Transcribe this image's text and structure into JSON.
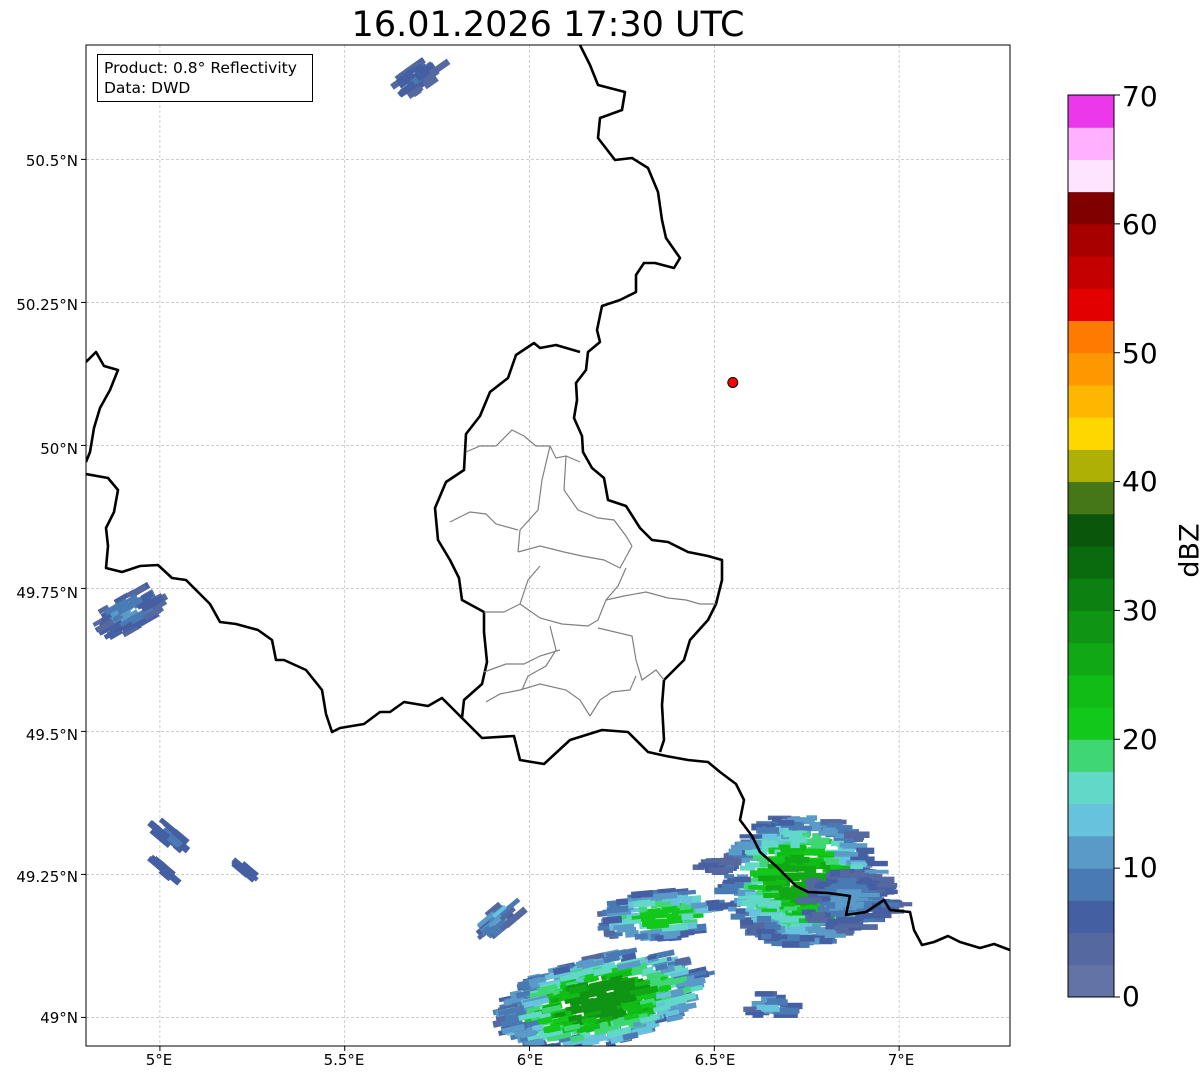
{
  "title": "16.01.2026 17:30 UTC",
  "info_box": {
    "product": "Product: 0.8° Reflectivity",
    "data": "Data: DWD"
  },
  "axes": {
    "lat_ticks": [
      "50.5°N",
      "50.25°N",
      "50°N",
      "49.75°N",
      "49.5°N",
      "49.25°N",
      "49°N"
    ],
    "lon_ticks": [
      "5°E",
      "5.5°E",
      "6°E",
      "6.5°E",
      "7°E"
    ],
    "lon_range": [
      4.8,
      7.3
    ],
    "lat_range": [
      48.95,
      50.7
    ],
    "grid": true
  },
  "marker": {
    "lon": 6.55,
    "lat": 50.11,
    "color": "#ff0000"
  },
  "colorbar": {
    "label": "dBZ",
    "ticks": [
      "0",
      "10",
      "20",
      "30",
      "40",
      "50",
      "60",
      "70"
    ],
    "range": [
      0,
      70
    ],
    "step": 2.5,
    "colors": [
      "#6373a6",
      "#5568a0",
      "#455fa3",
      "#4a7ab3",
      "#5a9ac8",
      "#67c2dd",
      "#62d8c8",
      "#3fd776",
      "#12c81a",
      "#11bc16",
      "#11a815",
      "#0f9414",
      "#0c8011",
      "#0a6b0e",
      "#0a560b",
      "#457617",
      "#afb006",
      "#ffd700",
      "#ffb600",
      "#ff9800",
      "#ff7a00",
      "#e30000",
      "#c50000",
      "#a80000",
      "#800000",
      "#ffe4ff",
      "#ffb0ff",
      "#ff70f8",
      "#ea38ea"
    ]
  }
}
